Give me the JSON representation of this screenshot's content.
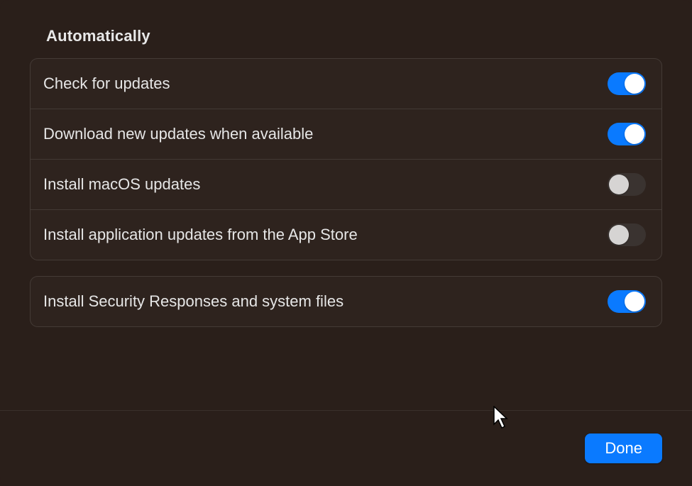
{
  "section_title": "Automatically",
  "group1": {
    "items": [
      {
        "label": "Check for updates",
        "on": true
      },
      {
        "label": "Download new updates when available",
        "on": true
      },
      {
        "label": "Install macOS updates",
        "on": false
      },
      {
        "label": "Install application updates from the App Store",
        "on": false
      }
    ]
  },
  "group2": {
    "items": [
      {
        "label": "Install Security Responses and system files",
        "on": true
      }
    ]
  },
  "footer": {
    "done_label": "Done"
  }
}
